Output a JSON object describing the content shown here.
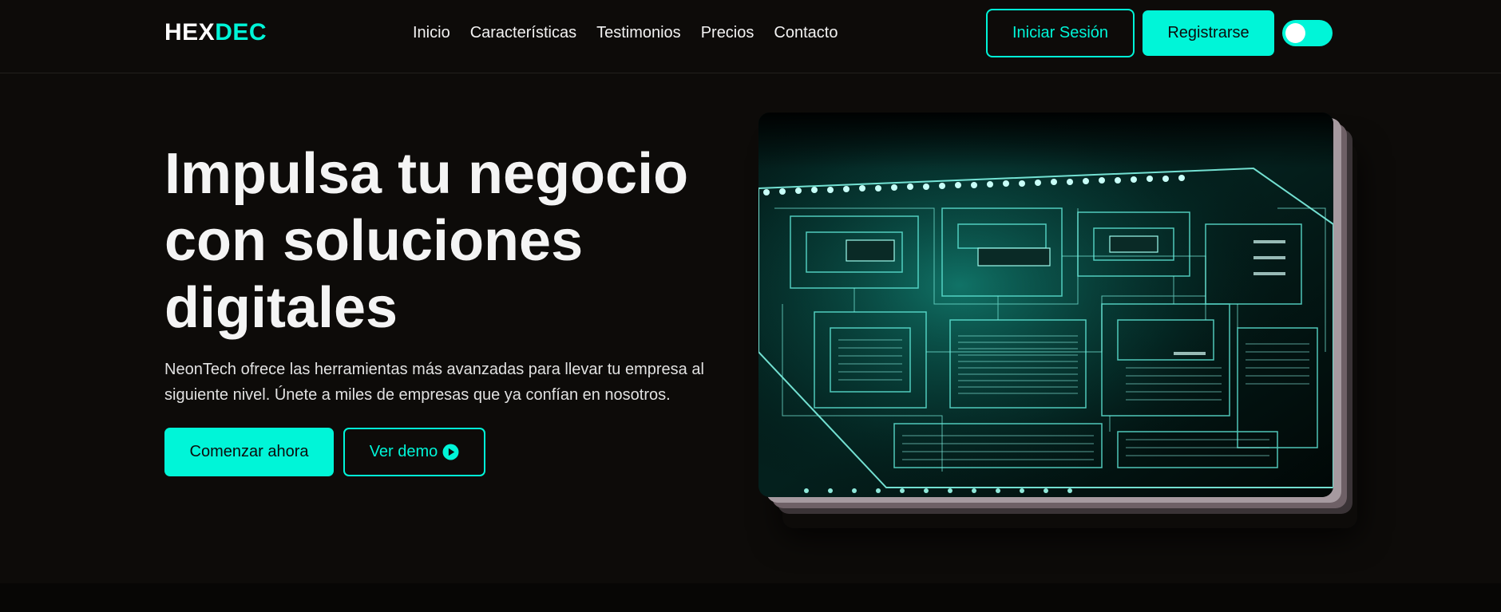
{
  "header": {
    "logo": {
      "part1": "HEX",
      "part2": "DEC"
    },
    "nav": [
      "Inicio",
      "Características",
      "Testimonios",
      "Precios",
      "Contacto"
    ],
    "login_label": "Iniciar Sesión",
    "register_label": "Registrarse"
  },
  "hero": {
    "title_line1": "Impulsa tu negocio",
    "title_line2": "con soluciones",
    "title_line3": "digitales",
    "subtitle_line1": "NeonTech ofrece las herramientas más avanzadas para llevar tu empresa al",
    "subtitle_line2": "siguiente nivel. Únete a miles de empresas que ya confían en nosotros.",
    "primary_cta": "Comenzar ahora",
    "secondary_cta": "Ver demo",
    "image_subject": "circuit-board-photo"
  },
  "theme": {
    "accent": "#00f5d8",
    "background": "#0d0b09",
    "toggle_on": true
  }
}
